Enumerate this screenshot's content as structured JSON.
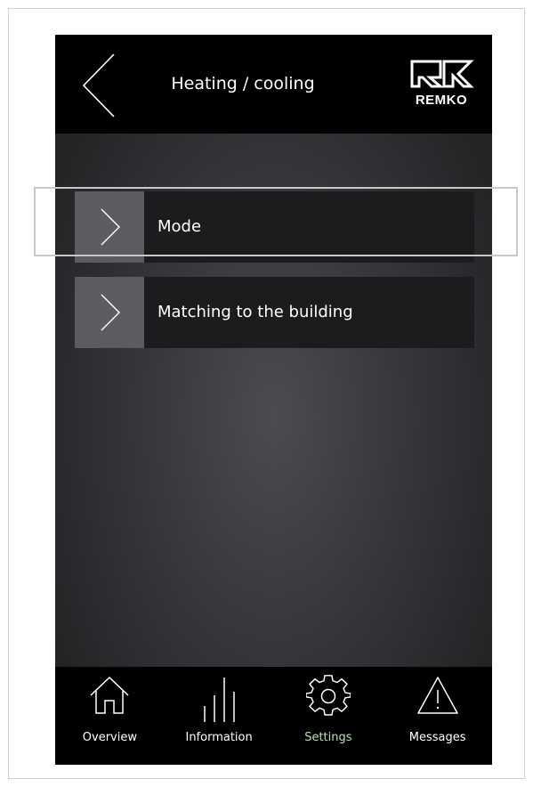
{
  "header": {
    "title": "Heating / cooling",
    "logo_text": "REMKO"
  },
  "menu": {
    "items": [
      {
        "label": "Mode",
        "icon": "chevron-right-icon"
      },
      {
        "label": "Matching to the building",
        "icon": "chevron-right-icon"
      }
    ]
  },
  "nav": {
    "items": [
      {
        "label": "Overview",
        "icon": "home-icon",
        "active": false
      },
      {
        "label": "Information",
        "icon": "bar-chart-icon",
        "active": false
      },
      {
        "label": "Settings",
        "icon": "gear-icon",
        "active": true
      },
      {
        "label": "Messages",
        "icon": "warning-icon",
        "active": false
      }
    ]
  },
  "colors": {
    "header_bg": "#000000",
    "item_bg": "#1c1c1e",
    "chevron_box_bg": "#5b5c60",
    "active_nav": "#b8e0b0",
    "highlight_border": "#c8c8c8"
  }
}
